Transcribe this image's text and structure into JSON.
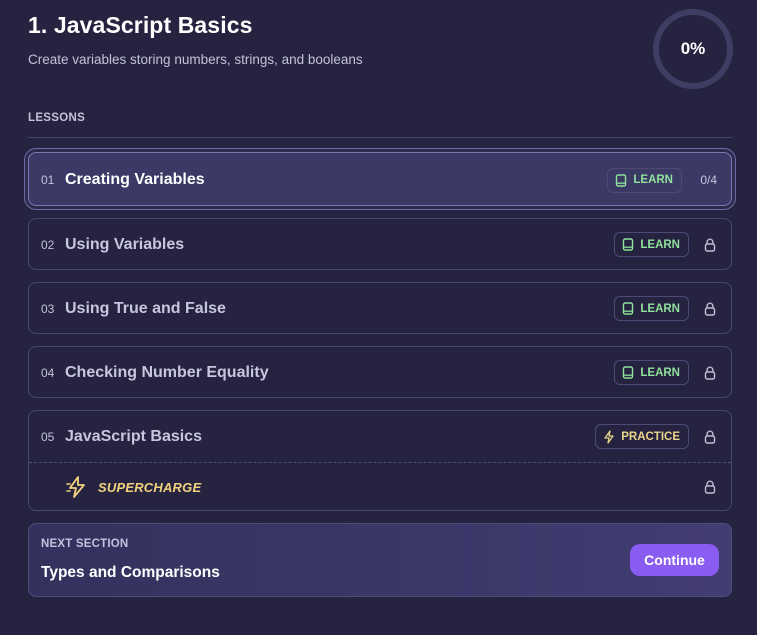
{
  "header": {
    "title": "1. JavaScript Basics",
    "subtitle": "Create variables storing numbers, strings, and booleans",
    "progress": "0%"
  },
  "lessons_label": "LESSONS",
  "lessons": [
    {
      "num": "01",
      "name": "Creating Variables",
      "tag": "LEARN",
      "status": "0/4",
      "active": true
    },
    {
      "num": "02",
      "name": "Using Variables",
      "tag": "LEARN",
      "status": "locked"
    },
    {
      "num": "03",
      "name": "Using True and False",
      "tag": "LEARN",
      "status": "locked"
    },
    {
      "num": "04",
      "name": "Checking Number Equality",
      "tag": "LEARN",
      "status": "locked"
    },
    {
      "num": "05",
      "name": "JavaScript Basics",
      "tag": "PRACTICE",
      "status": "locked"
    }
  ],
  "supercharge": {
    "label": "SUPERCHARGE",
    "status": "locked"
  },
  "next_section": {
    "label": "NEXT SECTION",
    "title": "Types and Comparisons",
    "button": "Continue"
  },
  "colors": {
    "background": "#25233f",
    "learn": "#8fe19b",
    "practice": "#ebd58a",
    "accent": "#8a5cf2"
  },
  "icons": {
    "learn": "book-icon",
    "practice": "lightning-icon",
    "locked": "lock-icon",
    "supercharge": "lightning-icon"
  }
}
